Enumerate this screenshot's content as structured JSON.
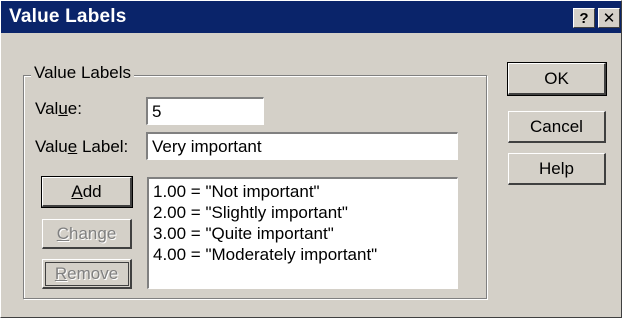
{
  "window": {
    "title": "Value Labels",
    "help_glyph": "?",
    "close_glyph": "✕"
  },
  "group": {
    "legend": "Value Labels",
    "value_label_text": "Value:",
    "value_input": "5",
    "value_label_label_text": "Value Label:",
    "value_label_input": "Very important"
  },
  "buttons": {
    "add": "Add",
    "change": "Change",
    "remove": "Remove",
    "ok": "OK",
    "cancel": "Cancel",
    "help": "Help"
  },
  "list": {
    "items": [
      "1.00 = \"Not important\"",
      "2.00 = \"Slightly important\"",
      "3.00 = \"Quite important\"",
      "4.00 = \"Moderately important\""
    ]
  }
}
